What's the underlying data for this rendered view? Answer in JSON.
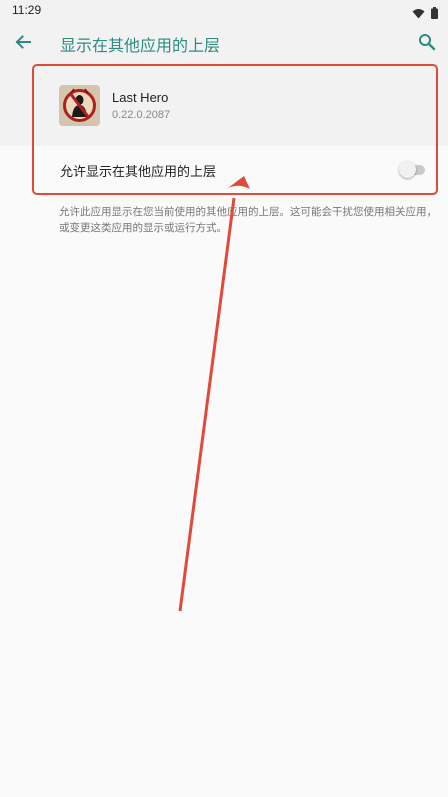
{
  "status": {
    "time": "11:29"
  },
  "appbar": {
    "title": "显示在其他应用的上层"
  },
  "app": {
    "name": "Last Hero",
    "version": "0.22.0.2087"
  },
  "setting": {
    "label": "允许显示在其他应用的上层",
    "enabled": false,
    "description": "允许此应用显示在您当前使用的其他应用的上层。这可能会干扰您使用相关应用，或变更这类应用的显示或运行方式。"
  },
  "colors": {
    "accent": "#2d8b82",
    "annotation": "#e04a3a"
  },
  "icons": [
    "wifi-icon",
    "battery-icon",
    "back-arrow-icon",
    "search-icon",
    "app-icon"
  ]
}
